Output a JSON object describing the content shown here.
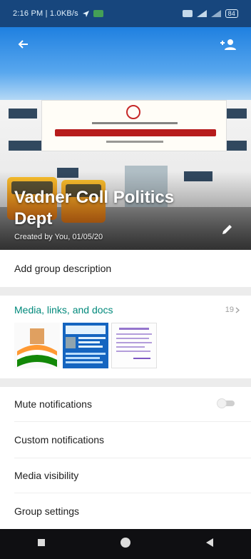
{
  "status_bar": {
    "time_speed": "2:16 PM | 1.0KB/s",
    "battery": "84"
  },
  "header": {
    "group_name": "Vadner Coll Politics Dept",
    "created_info": "Created by You, 01/05/20"
  },
  "rows": {
    "description_label": "Add group description",
    "media_label": "Media, links, and docs",
    "media_count": "19",
    "mute_label": "Mute notifications",
    "mute_enabled": false,
    "custom_notifications_label": "Custom notifications",
    "media_visibility_label": "Media visibility",
    "group_settings_label": "Group settings"
  },
  "icons": {
    "back": "arrow-left-icon",
    "add_participant": "person-add-icon",
    "edit": "pencil-icon",
    "chevron": "chevron-right-icon",
    "nav_recent": "square-icon",
    "nav_home": "circle-icon",
    "nav_back": "triangle-left-icon"
  },
  "colors": {
    "accent": "#00897b",
    "status_bar": "#17467d"
  }
}
